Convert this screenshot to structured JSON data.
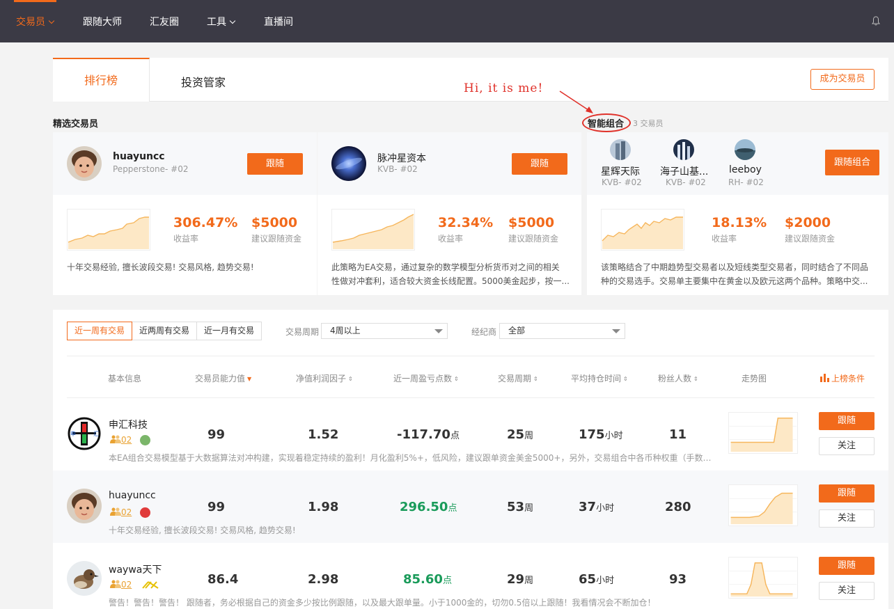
{
  "nav": {
    "items": [
      {
        "label": "交易员",
        "has_caret": true,
        "active": true
      },
      {
        "label": "跟随大师"
      },
      {
        "label": "汇友圈"
      },
      {
        "label": "工具",
        "has_caret": true
      },
      {
        "label": "直播间"
      }
    ],
    "bell_icon": "bell-icon"
  },
  "tabs": {
    "rank": "排行榜",
    "invest": "投资管家",
    "become_trader": "成为交易员"
  },
  "annotation": "Hi, it is me!",
  "featured": {
    "title": "精选交易员",
    "combo_title": "智能组合",
    "combo_count": "3 交易员",
    "cards": [
      {
        "name": "huayuncc",
        "sub": "Pepperstone- #02",
        "follow": "跟随",
        "return_value": "306.47%",
        "return_label": "收益率",
        "capital_value": "$5000",
        "capital_label": "建议跟随资金",
        "desc": "十年交易经验, 擅长波段交易! 交易风格, 趋势交易!"
      },
      {
        "name": "脉冲星资本",
        "sub": "KVB- #02",
        "follow": "跟随",
        "return_value": "32.34%",
        "return_label": "收益率",
        "capital_value": "$5000",
        "capital_label": "建议跟随资金",
        "desc_line1": "此策略为EA交易，通过复杂的数学模型分析货币对之间的相关",
        "desc_line2": "性做对冲套利，适合较大资金长线配置。5000美金起步，按一..."
      }
    ],
    "combo": {
      "members": [
        {
          "name": "星辉天际",
          "sub": "KVB- #02"
        },
        {
          "name": "海子山基...",
          "sub": "KVB- #02"
        },
        {
          "name": "leeboy",
          "sub": "RH- #02"
        }
      ],
      "follow": "跟随组合",
      "return_value": "18.13%",
      "return_label": "收益率",
      "capital_value": "$2000",
      "capital_label": "建议跟随资金",
      "desc_line1": "该策略结合了中期趋势型交易者以及短线类型交易者，同时结合了不同品",
      "desc_line2": "种的交易选手。交易单主要集中在黄金以及欧元这两个品种。策略中交..."
    }
  },
  "filters": {
    "period_buttons": [
      "近一周有交易",
      "近两周有交易",
      "近一月有交易"
    ],
    "cycle_label": "交易周期",
    "cycle_value": "4周以上",
    "broker_label": "经纪商",
    "broker_value": "全部"
  },
  "table": {
    "headers": {
      "basic": "基本信息",
      "ability": "交易员能力值",
      "profit_factor": "净值利润因子",
      "week_pnl": "近一周盈亏点数",
      "cycle": "交易周期",
      "hold": "平均持仓时间",
      "fans": "粉丝人数",
      "trend": "走势图",
      "condition": "上榜条件"
    },
    "rows": [
      {
        "name": "申汇科技",
        "level": "02",
        "ability": "99",
        "profit_factor": "1.52",
        "week_pnl": "-117.70",
        "pnl_unit": "点",
        "cycle": "25",
        "cycle_unit": "周",
        "hold": "175",
        "hold_unit": "小时",
        "fans": "11",
        "desc": "本EA组合交易模型基于大数据算法对冲构建，实现着稳定持续的盈利！月化盈利5%+，低风险，建议跟单资金美金5000+，另外，交易组合中各币种权重（手数）...",
        "follow": "跟随",
        "watch": "关注"
      },
      {
        "name": "huayuncc",
        "level": "02",
        "ability": "99",
        "profit_factor": "1.98",
        "week_pnl": "296.50",
        "pnl_unit": "点",
        "cycle": "53",
        "cycle_unit": "周",
        "hold": "37",
        "hold_unit": "小时",
        "fans": "280",
        "desc": "十年交易经验, 擅长波段交易! 交易风格, 趋势交易!",
        "follow": "跟随",
        "watch": "关注"
      },
      {
        "name": "waywa天下",
        "level": "02",
        "ability": "86.4",
        "profit_factor": "2.98",
        "week_pnl": "85.60",
        "pnl_unit": "点",
        "cycle": "29",
        "cycle_unit": "周",
        "hold": "65",
        "hold_unit": "小时",
        "fans": "93",
        "desc": "警告！警告！警告！ 跟随者，务必根据自己的资金多少按比例跟随，以及最大跟单量。小于1000金的，切勿0.5倍以上跟随！我看情况会不断加仓！",
        "follow": "跟随",
        "watch": "关注"
      }
    ]
  },
  "colors": {
    "nav_bg": "#3b3a45",
    "accent": "#f26a1b",
    "positive": "#1a9b5a",
    "annotation": "#e0312a"
  }
}
